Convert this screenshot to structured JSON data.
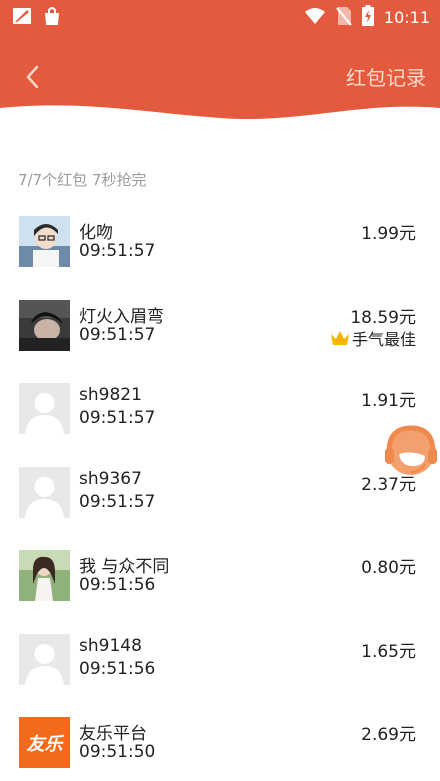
{
  "status_bar": {
    "time": "10:11"
  },
  "nav": {
    "title": "红包记录"
  },
  "summary": "7/7个红包 7秒抢完",
  "records": [
    {
      "name": "化吻",
      "time": "09:51:57",
      "amount": "1.99元",
      "avatar": "photo-boy"
    },
    {
      "name": "灯火入眉弯",
      "time": "09:51:57",
      "amount": "18.59元",
      "avatar": "photo-dark",
      "best": "手气最佳"
    },
    {
      "name": "sh9821",
      "time": "09:51:57",
      "amount": "1.91元",
      "avatar": "default"
    },
    {
      "name": "sh9367",
      "time": "09:51:57",
      "amount": "2.37元",
      "avatar": "default"
    },
    {
      "name": "我 与众不同",
      "time": "09:51:56",
      "amount": "0.80元",
      "avatar": "photo-girl"
    },
    {
      "name": "sh9148",
      "time": "09:51:56",
      "amount": "1.65元",
      "avatar": "default"
    },
    {
      "name": "友乐平台",
      "time": "09:51:50",
      "amount": "2.69元",
      "avatar": "logo",
      "logo_text": "友乐"
    }
  ],
  "colors": {
    "header": "#e45a3e",
    "nav_title": "#ffd9c9",
    "crown": "#f5b400"
  }
}
